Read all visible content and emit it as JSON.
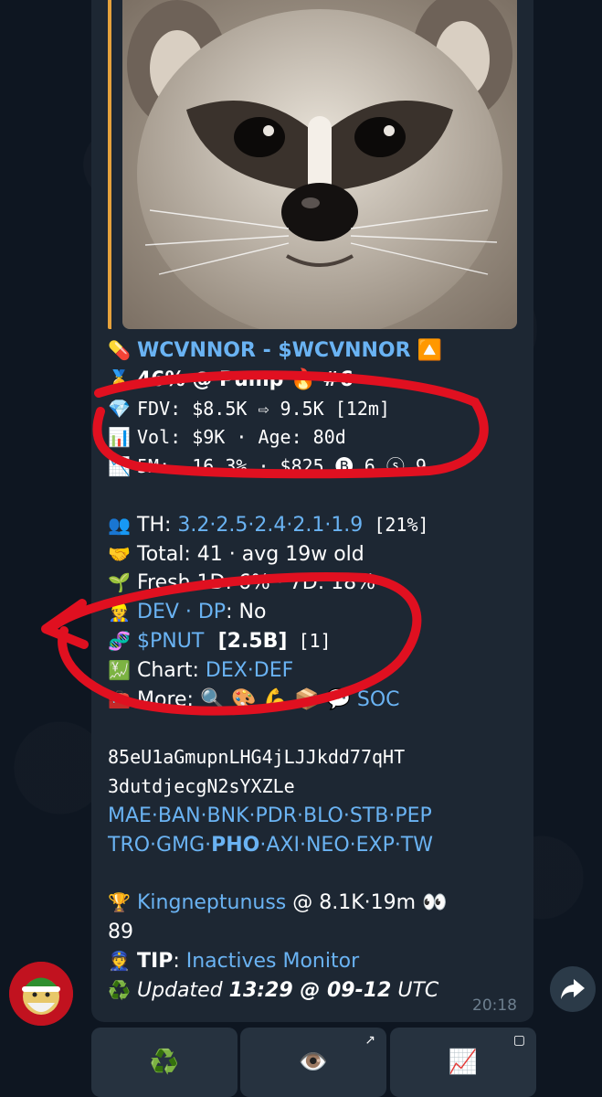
{
  "message": {
    "lines": [
      {
        "icon": "💊",
        "parts": [
          {
            "t": "WCVNNOR - $WCVNNOR",
            "c": "link b"
          },
          {
            "t": " 🔼",
            "c": ""
          }
        ]
      },
      {
        "icon": "🥇",
        "parts": [
          {
            "t": "46% @ Pump 🔥 #6",
            "c": "b"
          }
        ]
      },
      {
        "icon": "💎",
        "parts": [
          {
            "t": "FDV: $8.5K ⇨ 9.5K [12m]",
            "c": "mono"
          }
        ]
      },
      {
        "icon": "📊",
        "parts": [
          {
            "t": "Vol: $9K · Age: 80d",
            "c": "mono"
          }
        ]
      },
      {
        "icon": "📉",
        "parts": [
          {
            "t": "5M: -16.3% · $825 🅑 6 ⓢ 9",
            "c": "mono"
          }
        ]
      },
      {
        "icon": "",
        "parts": []
      },
      {
        "icon": "👥",
        "parts": [
          {
            "t": "TH: ",
            "c": ""
          },
          {
            "t": "3.2·2.5·2.4·2.1·1.9",
            "c": "link"
          },
          {
            "t": " [21%]",
            "c": "mono"
          }
        ]
      },
      {
        "icon": "🤝",
        "parts": [
          {
            "t": "Total: 41 · avg 19w old",
            "c": ""
          }
        ]
      },
      {
        "icon": "🌱",
        "parts": [
          {
            "t": "Fresh 1D: 6% · 7D: 18%",
            "c": ""
          }
        ]
      },
      {
        "icon": "👷",
        "parts": [
          {
            "t": "DEV · DP",
            "c": "link"
          },
          {
            "t": ": No",
            "c": ""
          }
        ]
      },
      {
        "icon": "🧬",
        "parts": [
          {
            "t": "$PNUT",
            "c": "link"
          },
          {
            "t": "  [2.5B]",
            "c": "b"
          },
          {
            "t": " [1]",
            "c": "mono"
          }
        ]
      },
      {
        "icon": "💹",
        "parts": [
          {
            "t": "Chart: ",
            "c": ""
          },
          {
            "t": "DEX·DEF",
            "c": "link"
          }
        ]
      },
      {
        "icon": "🧰",
        "parts": [
          {
            "t": "More: 🔍 🎨 💪 📦 💬 ",
            "c": ""
          },
          {
            "t": "SOC",
            "c": "link"
          }
        ]
      },
      {
        "icon": "",
        "parts": []
      },
      {
        "icon": "",
        "parts": [
          {
            "t": "85eU1aGmupnLHG4jLJJkdd77qHT",
            "c": "mono"
          }
        ]
      },
      {
        "icon": "",
        "parts": [
          {
            "t": "3dutdjecgN2sYXZLe",
            "c": "mono"
          }
        ]
      },
      {
        "icon": "",
        "parts": [
          {
            "t": "MAE·BAN·BNK·PDR·BLO·STB·PEP",
            "c": "link"
          }
        ]
      },
      {
        "icon": "",
        "parts": [
          {
            "t": "TRO·GMG·",
            "c": "link"
          },
          {
            "t": "PHO",
            "c": "link b"
          },
          {
            "t": "·AXI·NEO·EXP·TW",
            "c": "link"
          }
        ]
      },
      {
        "icon": "",
        "parts": []
      },
      {
        "icon": "🏆",
        "parts": [
          {
            "t": "Kingneptunuss",
            "c": "link"
          },
          {
            "t": " @ 8.1K·19m 👀",
            "c": ""
          }
        ]
      },
      {
        "icon": "",
        "parts": [
          {
            "t": "89",
            "c": ""
          }
        ]
      },
      {
        "icon": "👮",
        "parts": [
          {
            "t": "TIP",
            "c": "b"
          },
          {
            "t": ": ",
            "c": ""
          },
          {
            "t": "Inactives Monitor",
            "c": "link"
          }
        ]
      },
      {
        "icon": "♻️",
        "parts": [
          {
            "t": "Updated ",
            "c": "i"
          },
          {
            "t": "13:29 @ 09-12",
            "c": "i b"
          },
          {
            "t": " UTC",
            "c": "i"
          }
        ]
      }
    ],
    "time": "20:18"
  },
  "keyboard": {
    "buttons": [
      {
        "icon": "♻️",
        "name": "refresh-button",
        "corner": ""
      },
      {
        "icon": "👁️",
        "name": "scan-button",
        "corner": "↗"
      },
      {
        "icon": "📈",
        "name": "chart-button",
        "corner": "▢"
      }
    ]
  },
  "colors": {
    "accent": "#6ab3f3",
    "bubble": "#1d2733",
    "quote": "#e6a23c",
    "annotation": "#e01020"
  }
}
